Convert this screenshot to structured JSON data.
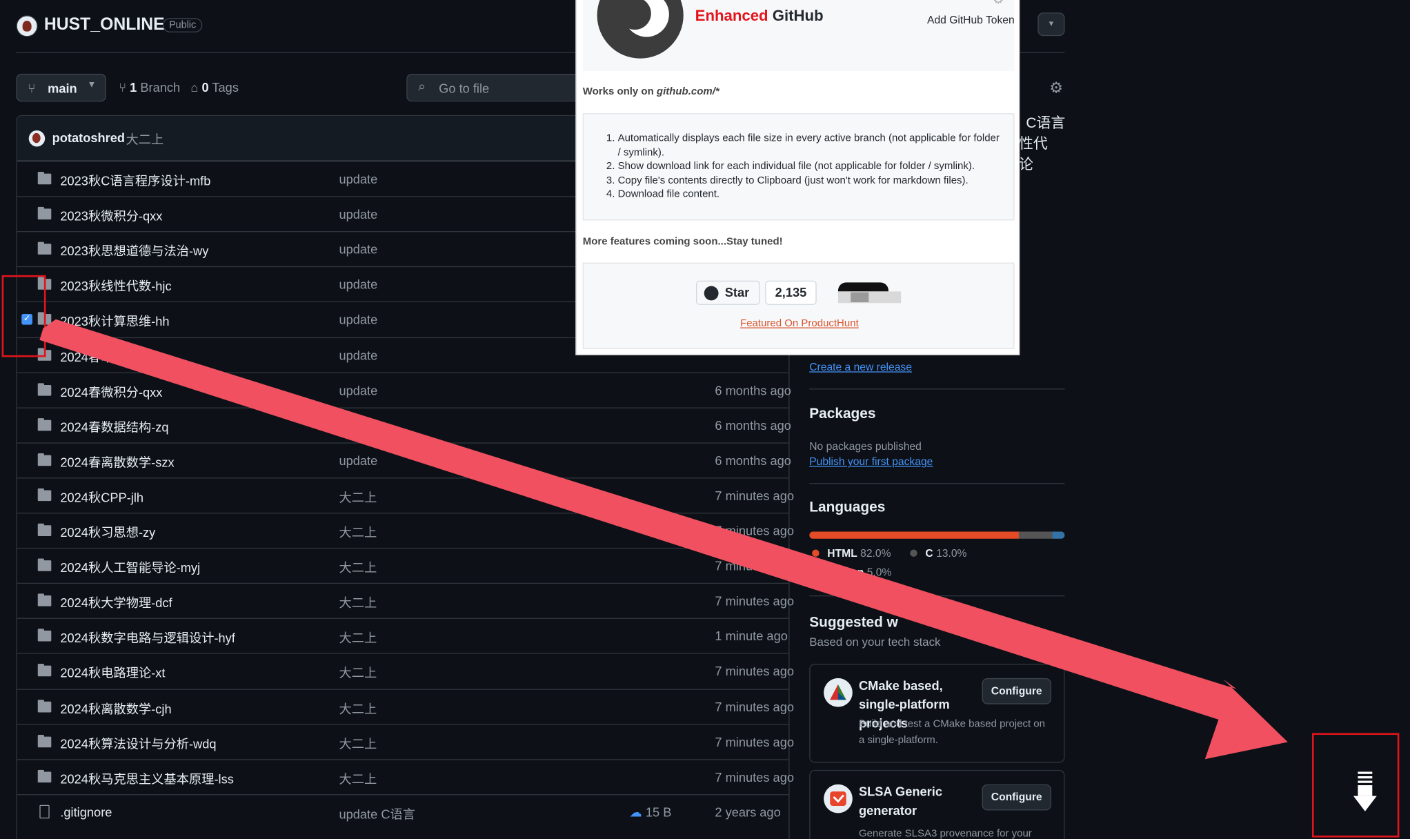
{
  "repo": {
    "name": "HUST_ONLINE",
    "visibility": "Public"
  },
  "toolbar": {
    "branch": "main",
    "branch_count": "1",
    "branch_label": "Branch",
    "tag_count": "0",
    "tag_label": "Tags",
    "goto_placeholder": "Go to file"
  },
  "commit": {
    "author": "potatoshred",
    "message": "大二上"
  },
  "files": [
    {
      "name": "2023秋C语言程序设计-mfb",
      "message": "update",
      "date": "",
      "type": "folder",
      "checked": false
    },
    {
      "name": "2023秋微积分-qxx",
      "message": "update",
      "date": "",
      "type": "folder",
      "checked": false
    },
    {
      "name": "2023秋思想道德与法治-wy",
      "message": "update",
      "date": "",
      "type": "folder",
      "checked": false
    },
    {
      "name": "2023秋线性代数-hjc",
      "message": "update",
      "date": "",
      "type": "folder",
      "checked": false
    },
    {
      "name": "2023秋计算思维-hh",
      "message": "update",
      "date": "",
      "type": "folder",
      "checked": true
    },
    {
      "name": "2024春军事理论",
      "message": "update",
      "date": "",
      "type": "folder",
      "checked": false
    },
    {
      "name": "2024春微积分-qxx",
      "message": "update",
      "date": "6 months ago",
      "type": "folder",
      "checked": false
    },
    {
      "name": "2024春数据结构-zq",
      "message": "update",
      "date": "6 months ago",
      "type": "folder",
      "checked": false
    },
    {
      "name": "2024春离散数学-szx",
      "message": "update",
      "date": "6 months ago",
      "type": "folder",
      "checked": false
    },
    {
      "name": "2024秋CPP-jlh",
      "message": "大二上",
      "date": "7 minutes ago",
      "type": "folder",
      "checked": false
    },
    {
      "name": "2024秋习思想-zy",
      "message": "大二上",
      "date": "7 minutes ago",
      "type": "folder",
      "checked": false
    },
    {
      "name": "2024秋人工智能导论-myj",
      "message": "大二上",
      "date": "7 minutes ago",
      "type": "folder",
      "checked": false
    },
    {
      "name": "2024秋大学物理-dcf",
      "message": "大二上",
      "date": "7 minutes ago",
      "type": "folder",
      "checked": false
    },
    {
      "name": "2024秋数字电路与逻辑设计-hyf",
      "message": "大二上",
      "date": "1 minute ago",
      "type": "folder",
      "checked": false
    },
    {
      "name": "2024秋电路理论-xt",
      "message": "大二上",
      "date": "7 minutes ago",
      "type": "folder",
      "checked": false
    },
    {
      "name": "2024秋离散数学-cjh",
      "message": "大二上",
      "date": "7 minutes ago",
      "type": "folder",
      "checked": false
    },
    {
      "name": "2024秋算法设计与分析-wdq",
      "message": "大二上",
      "date": "7 minutes ago",
      "type": "folder",
      "checked": false
    },
    {
      "name": "2024秋马克思主义基本原理-lss",
      "message": "大二上",
      "date": "7 minutes ago",
      "type": "folder",
      "checked": false
    },
    {
      "name": ".gitignore",
      "message": "update C语言",
      "size": "15 B",
      "date": "2 years ago",
      "type": "file",
      "checked": false
    }
  ],
  "sidebar": {
    "about_fragments": [
      "C语言",
      "性代",
      "论"
    ],
    "create_release": "Create a new release",
    "packages": {
      "title": "Packages",
      "empty": "No packages published",
      "link": "Publish your first package"
    },
    "languages": {
      "title": "Languages",
      "items": [
        {
          "name": "HTML",
          "percent": "82.0%",
          "value": 82.0,
          "color": "#e34c26"
        },
        {
          "name": "C",
          "percent": "13.0%",
          "value": 13.0,
          "color": "#555555"
        },
        {
          "name": "Python",
          "percent": "5.0%",
          "value": 5.0,
          "color": "#3572a5"
        }
      ]
    },
    "suggested": {
      "title": "Suggested w",
      "subtitle": "Based on your tech stack",
      "cards": [
        {
          "title": "CMake based, single-platform projects",
          "desc": "Build and test a CMake based project on a single-platform.",
          "button": "Configure"
        },
        {
          "title": "SLSA Generic generator",
          "desc": "Generate SLSA3 provenance for your",
          "button": "Configure"
        }
      ]
    }
  },
  "popup": {
    "title_red": "Enhanced",
    "title_rest": " GitHub",
    "token_link": "Add GitHub Token",
    "works_prefix": "Works only on ",
    "works_domain": "github.com/*",
    "features": [
      "Automatically displays each file size in every active branch (not applicable for folder / symlink).",
      "Show download link for each individual file (not applicable for folder / symlink).",
      "Copy file's contents directly to Clipboard (just won't work for markdown files).",
      "Download file content."
    ],
    "more": "More features coming soon...Stay tuned!",
    "star_label": "Star",
    "star_count": "2,135",
    "producthunt": "Featured On ProductHunt"
  },
  "colors": {
    "accent": "#4493f8",
    "annotation": "#e0141c",
    "arrow": "#f0505f"
  }
}
